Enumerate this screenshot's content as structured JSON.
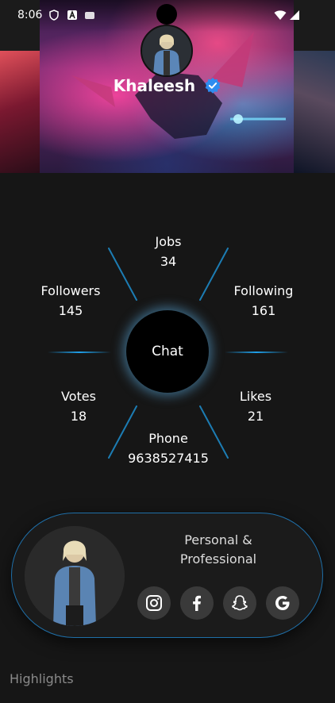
{
  "status_bar": {
    "time": "8:06"
  },
  "profile": {
    "name": "Khaleesh"
  },
  "stats": {
    "jobs": {
      "label": "Jobs",
      "value": "34"
    },
    "followers": {
      "label": "Followers",
      "value": "145"
    },
    "following": {
      "label": "Following",
      "value": "161"
    },
    "votes": {
      "label": "Votes",
      "value": "18"
    },
    "likes": {
      "label": "Likes",
      "value": "21"
    },
    "phone": {
      "label": "Phone",
      "value": "9638527415"
    }
  },
  "chat": {
    "label": "Chat"
  },
  "card": {
    "title_line1": "Personal &",
    "title_line2": "Professional",
    "socials": [
      "instagram-icon",
      "facebook-icon",
      "snapchat-icon",
      "google-icon"
    ]
  },
  "highlights": {
    "label": "Highlights"
  },
  "colors": {
    "accent": "#1f9fe8",
    "background": "#161616",
    "verified": "#2d8cf0"
  }
}
